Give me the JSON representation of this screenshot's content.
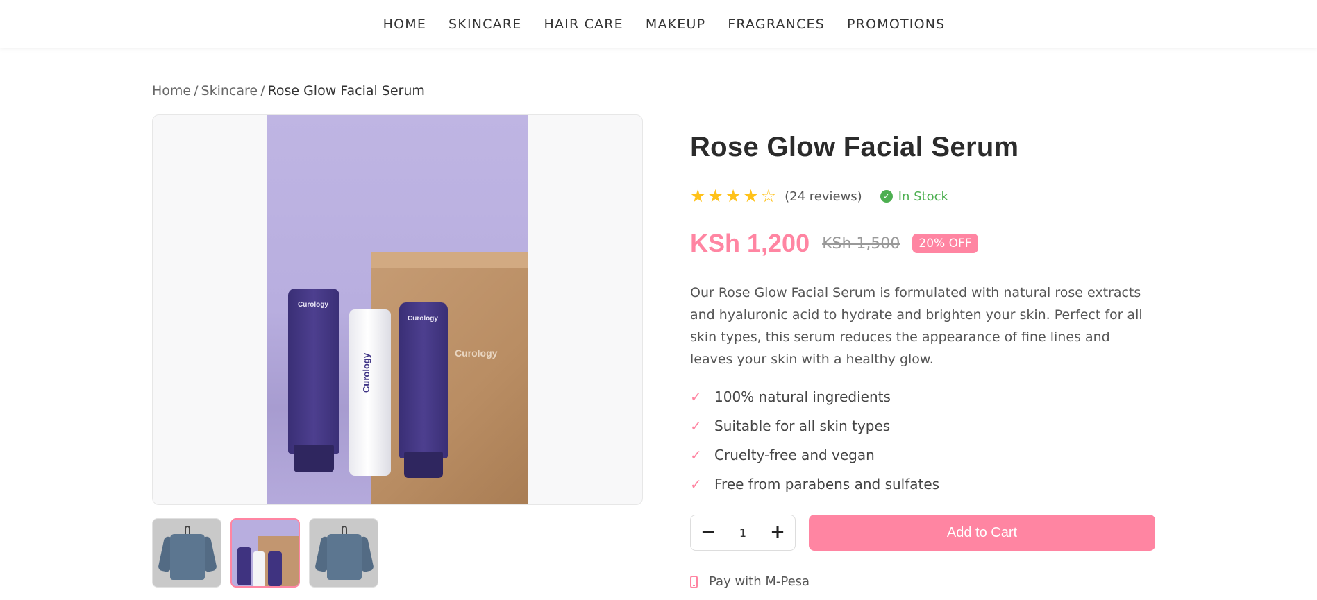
{
  "nav": {
    "items": [
      {
        "label": "HOME"
      },
      {
        "label": "SKINCARE"
      },
      {
        "label": "HAIR CARE"
      },
      {
        "label": "MAKEUP"
      },
      {
        "label": "FRAGRANCES"
      },
      {
        "label": "PROMOTIONS"
      }
    ]
  },
  "breadcrumb": {
    "home": "Home",
    "sep": "/",
    "category": "Skincare",
    "current": "Rose Glow Facial Serum"
  },
  "gallery": {
    "main_image": {
      "tube_brand": "Curology",
      "bottle_brand": "Curology",
      "box_brand": "Curology"
    },
    "thumbnails": [
      {
        "icon": "shirt-image",
        "active": false
      },
      {
        "icon": "serum-kit-image",
        "active": true
      },
      {
        "icon": "shirt-image",
        "active": false
      }
    ]
  },
  "product": {
    "title": "Rose Glow Facial Serum",
    "rating": 4,
    "rating_max": 5,
    "reviews": "(24 reviews)",
    "stock": "In Stock",
    "price": "KSh 1,200",
    "old_price": "KSh 1,500",
    "discount": "20% OFF",
    "description": "Our Rose Glow Facial Serum is formulated with natural rose extracts and hyaluronic acid to hydrate and brighten your skin. Perfect for all skin types, this serum reduces the appearance of fine lines and leaves your skin with a healthy glow.",
    "features": [
      "100% natural ingredients",
      "Suitable for all skin types",
      "Cruelty-free and vegan",
      "Free from parabens and sulfates"
    ],
    "quantity": "1",
    "add_to_cart": "Add to Cart",
    "payment": "Pay with M-Pesa"
  },
  "colors": {
    "accent": "#ff85a2",
    "star": "#ffc21a",
    "in_stock": "#4caf50"
  }
}
